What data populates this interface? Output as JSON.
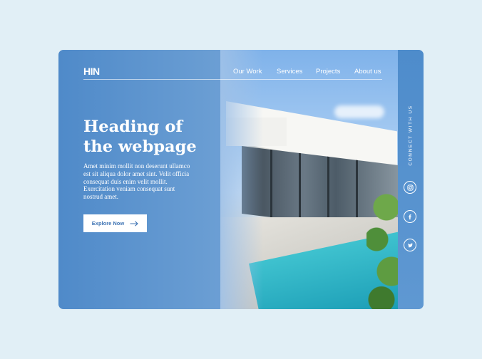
{
  "brand": {
    "logo": "HIN"
  },
  "nav": {
    "items": [
      "Our Work",
      "Services",
      "Projects",
      "About us"
    ]
  },
  "hero": {
    "heading_line1": "Heading of",
    "heading_line2": "the webpage",
    "body": "Amet minim mollit non deserunt ullamco est sit aliqua dolor amet sint. Velit officia consequat duis enim velit mollit. Exercitation veniam consequat sunt nostrud amet.",
    "cta_label": "Explore Now",
    "cta_icon": "arrow-right-icon"
  },
  "social": {
    "label": "CONNECT WITH US",
    "icons": [
      "instagram-icon",
      "facebook-icon",
      "twitter-icon"
    ]
  },
  "colors": {
    "page_bg": "#e1eff6",
    "accent": "#4f8ac9",
    "button_text": "#3f74b4"
  }
}
